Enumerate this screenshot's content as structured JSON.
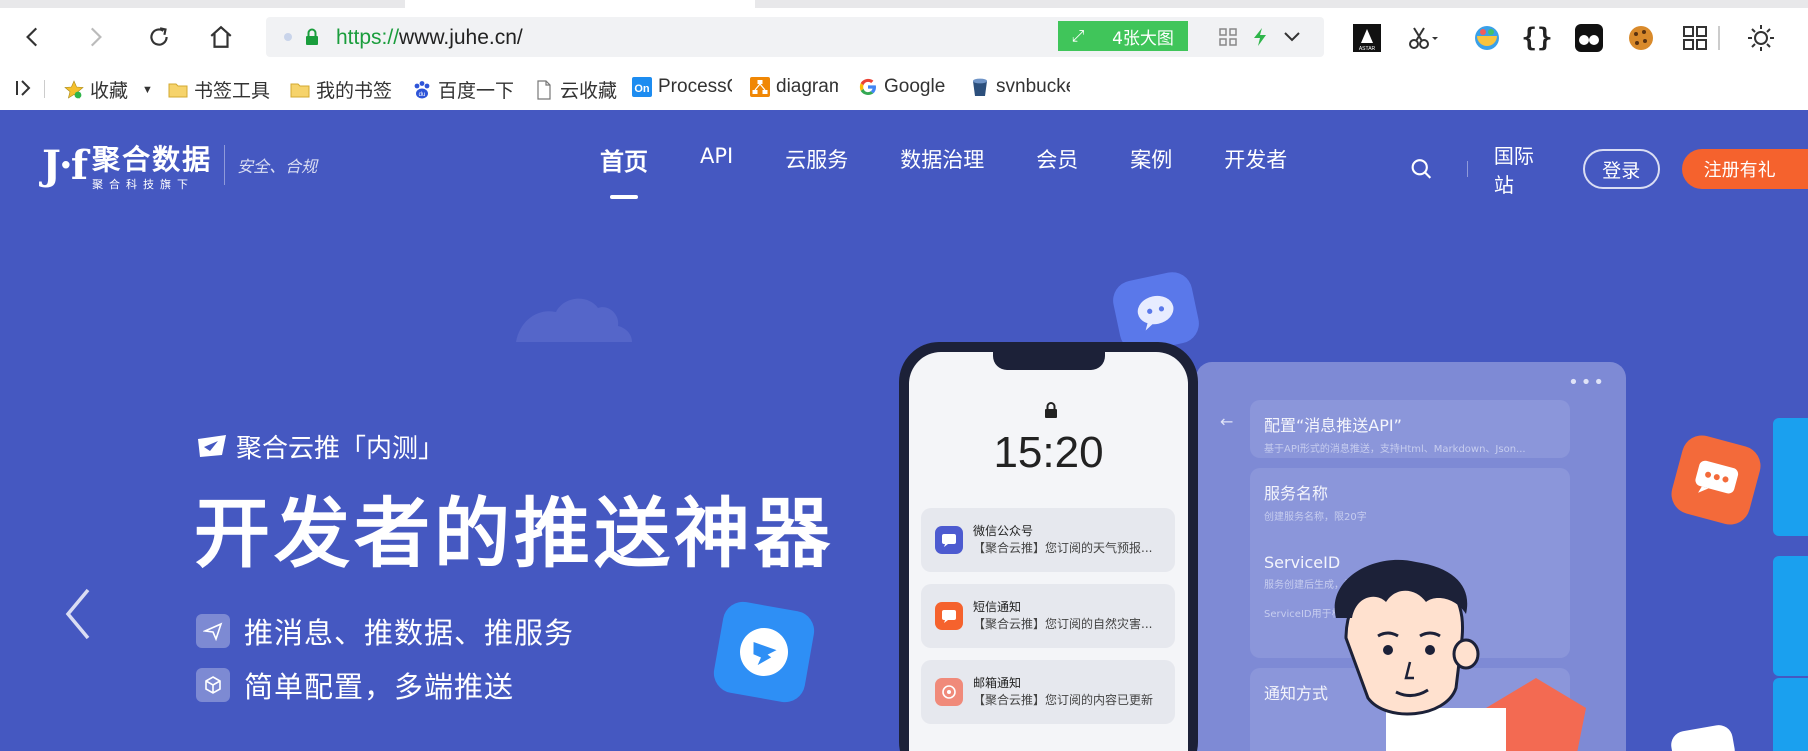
{
  "browser": {
    "url_protocol": "https://",
    "url_host": "www.juhe.cn/",
    "big_image_label": "4张大图",
    "colors": {
      "big_image_bg": "#40c55a",
      "lock": "#1a9d3c"
    }
  },
  "bookmarks": {
    "items": [
      {
        "label": "收藏",
        "icon": "star-icon"
      },
      {
        "label": "书签工具",
        "icon": "folder-icon"
      },
      {
        "label": "我的书签",
        "icon": "folder-icon"
      },
      {
        "label": "百度一下",
        "icon": "baidu-icon"
      },
      {
        "label": "云收藏",
        "icon": "page-icon"
      },
      {
        "label": "ProcessOn",
        "icon": "processon-icon"
      },
      {
        "label": "diagrams",
        "icon": "diagrams-icon"
      },
      {
        "label": "Google",
        "icon": "google-icon"
      },
      {
        "label": "svnbucket",
        "icon": "svn-icon"
      }
    ]
  },
  "site": {
    "logo_text": "聚合数据",
    "logo_sub": "聚合科技旗下",
    "logo_slogan": "安全、合规",
    "nav": [
      {
        "label": "首页",
        "active": true
      },
      {
        "label": "API"
      },
      {
        "label": "云服务"
      },
      {
        "label": "数据治理"
      },
      {
        "label": "会员"
      },
      {
        "label": "案例"
      },
      {
        "label": "开发者"
      }
    ],
    "intl_label": "国际站",
    "login_label": "登录",
    "register_label": "注册有礼",
    "colors": {
      "bg": "#4558c1",
      "register": "#f5622d"
    }
  },
  "hero": {
    "tag": "聚合云推「内测」",
    "title": "开发者的推送神器",
    "features": [
      "推消息、推数据、推服务",
      "简单配置，多端推送"
    ]
  },
  "phone": {
    "time": "15:20",
    "notifications": [
      {
        "title": "微信公众号",
        "body": "【聚合云推】您订阅的天气预报...",
        "color": "#4d5bd0"
      },
      {
        "title": "短信通知",
        "body": "【聚合云推】您订阅的自然灾害...",
        "color": "#f5622d"
      },
      {
        "title": "邮箱通知",
        "body": "【聚合云推】您订阅的内容已更新",
        "color": "#f08a7a"
      }
    ]
  },
  "panel": {
    "config_title": "配置“消息推送API”",
    "config_sub": "基于API形式的消息推送，支持Html、Markdown、Json...",
    "service_title": "服务名称",
    "service_sub": "创建服务名称，限20字",
    "serviceid_title": "ServiceID",
    "serviceid_sub": "服务创建后生成，需在API请求中使用",
    "serviceid_note": "ServiceID用于标识服务",
    "notify_title": "通知方式"
  }
}
